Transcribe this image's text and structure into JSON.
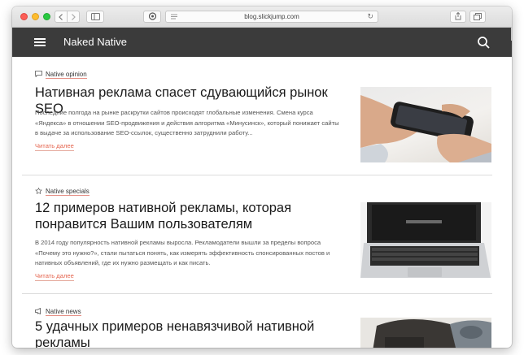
{
  "browser": {
    "url": "blog.slickjump.com",
    "back_icon": "chevron-left-icon",
    "forward_icon": "chevron-right-icon",
    "new_tab_label": "+"
  },
  "site": {
    "brand": "Naked Native",
    "header_color": "#3b3b3b",
    "accent_color": "#e5654f"
  },
  "articles": [
    {
      "category": "Native opinion",
      "category_icon": "chat-bubble-icon",
      "title_lines": [
        "Нативная реклама спасет сдувающийся рынок SEO"
      ],
      "desc_lines": [
        "Последние полгода на рынке раскрутки сайтов происходят глобальные изменения. Смена курса",
        "«Яндекса» в отношении SEO-продвижения и действия алгоритма «Минусинск», который понижает сайты",
        "в выдаче за использование SEO-ссылок, существенно затруднили работу..."
      ],
      "read_more": "Читать далее",
      "image": "hands-holding-smartphone"
    },
    {
      "category": "Native specials",
      "category_icon": "star-icon",
      "title_lines": [
        "12 примеров нативной рекламы, которая",
        "понравится Вашим пользователям"
      ],
      "desc_lines": [
        "В 2014 году популярность нативной рекламы выросла. Рекламодатели вышли за пределы вопроса",
        "«Почему это нужно?», стали пытаться понять, как измерять эффективность спонсированных постов и",
        "нативных объявлений, где их нужно размещать и как писать."
      ],
      "read_more": "Читать далее",
      "image": "laptop-on-desk"
    },
    {
      "category": "Native news",
      "category_icon": "megaphone-icon",
      "title_lines": [
        "5 удачных примеров ненавязчивой нативной",
        "рекламы"
      ],
      "image": "desk-with-notebook"
    }
  ]
}
